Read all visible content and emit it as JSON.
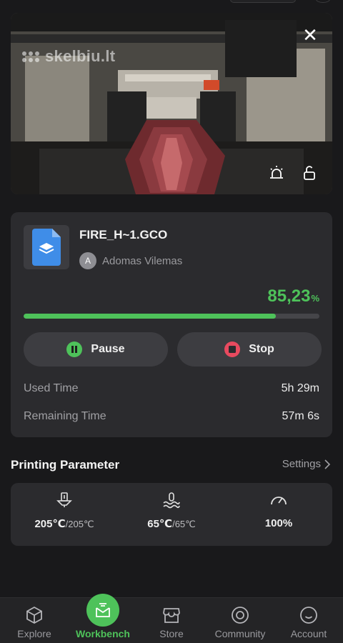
{
  "camera": {
    "watermark": "skelbiu.lt",
    "close_icon": "close-icon",
    "light_icon": "light-icon",
    "lock_icon": "unlock-icon"
  },
  "job": {
    "file_name": "FIRE_H~1.GCO",
    "owner_initial": "A",
    "owner_name": "Adomas Vilemas",
    "progress_text": "85,23",
    "progress_unit": "%",
    "progress_fraction": 0.8523,
    "pause_label": "Pause",
    "stop_label": "Stop",
    "used_time_label": "Used Time",
    "used_time_value": "5h 29m",
    "remaining_time_label": "Remaining Time",
    "remaining_time_value": "57m 6s"
  },
  "params": {
    "title": "Printing Parameter",
    "settings_label": "Settings",
    "nozzle": {
      "icon": "nozzle-temp-icon",
      "value": "205℃",
      "target": "/205℃"
    },
    "bed": {
      "icon": "bed-temp-icon",
      "value": "65℃",
      "target": "/65℃"
    },
    "speed": {
      "icon": "speed-gauge-icon",
      "value": "100%"
    }
  },
  "nav": {
    "items": [
      {
        "label": "Explore",
        "icon": "explore-icon"
      },
      {
        "label": "Workbench",
        "icon": "workbench-icon",
        "active": true
      },
      {
        "label": "Store",
        "icon": "store-icon"
      },
      {
        "label": "Community",
        "icon": "community-icon"
      },
      {
        "label": "Account",
        "icon": "account-icon"
      }
    ]
  },
  "colors": {
    "accent_green": "#4ec25a",
    "stop_red": "#e84a5f",
    "background": "#19191b",
    "card": "#2b2b2e"
  }
}
